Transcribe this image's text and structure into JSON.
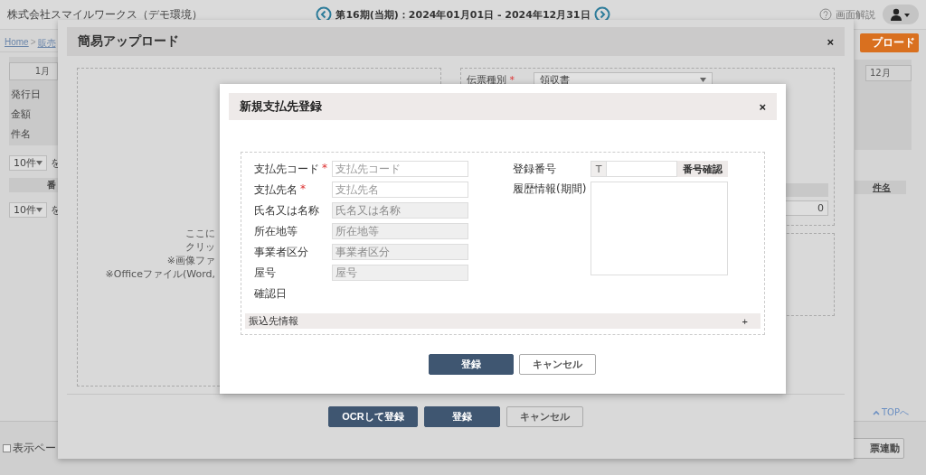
{
  "header": {
    "company": "株式会社スマイルワークス（デモ環境）",
    "period": "第16期(当期)：2024年01月01日 - 2024年12月31日",
    "help": "画面解説"
  },
  "page": {
    "breadcrumb": [
      {
        "label": "Home"
      },
      {
        "label": "販売"
      }
    ],
    "breadcrumb_separator": ">",
    "upload_button": "プロード",
    "months": [
      {
        "label": "1月"
      },
      {
        "label": "12月"
      }
    ],
    "fields": [
      "発行日",
      "金額",
      "件名"
    ],
    "page_size_selects": [
      {
        "value": "10件",
        "suffix": "を"
      },
      {
        "value": "10件",
        "suffix": "を"
      }
    ],
    "table_left_column": "番",
    "table_right_column": "件名",
    "top_link": "TOPへ",
    "footer_checkbox": {
      "label": "表示ペー",
      "checked": false
    },
    "footer_button": "票連動"
  },
  "upload_dialog": {
    "title": "簡易アップロード",
    "close": "×",
    "drop_text": [
      "ここに",
      "クリッ",
      "※画像ファ",
      "※Officeファイル(Word,"
    ],
    "slip_type": {
      "label": "伝票種別",
      "required_mark": "*",
      "value": "領収書"
    },
    "table_cell": "0",
    "buttons": [
      {
        "label": "OCRして登録",
        "kind": "primary"
      },
      {
        "label": "登録",
        "kind": "primary"
      },
      {
        "label": "キャンセル",
        "kind": "secondary"
      }
    ]
  },
  "payee_dialog": {
    "title": "新規支払先登録",
    "close": "×",
    "fields": [
      {
        "label": "支払先コード",
        "required_mark": "*",
        "kind": "input",
        "placeholder": "支払先コード",
        "disabled": false
      },
      {
        "label": "支払先名",
        "required_mark": "*",
        "kind": "input",
        "placeholder": "支払先名",
        "disabled": false
      },
      {
        "label": "氏名又は名称",
        "kind": "input",
        "placeholder": "氏名又は名称",
        "disabled": true
      },
      {
        "label": "所在地等",
        "kind": "input",
        "placeholder": "所在地等",
        "disabled": true
      },
      {
        "label": "事業者区分",
        "kind": "input",
        "placeholder": "事業者区分",
        "disabled": true
      },
      {
        "label": "屋号",
        "kind": "input",
        "placeholder": "屋号",
        "disabled": true
      },
      {
        "label": "確認日",
        "kind": "label"
      }
    ],
    "registration": {
      "label": "登録番号",
      "prefix": "T",
      "button": "番号確認"
    },
    "history": {
      "label": "履歴情報(期間)"
    },
    "bank_section": {
      "label": "振込先情報",
      "toggle": "+"
    },
    "buttons": [
      {
        "label": "登録",
        "kind": "primary"
      },
      {
        "label": "キャンセル",
        "kind": "secondary"
      }
    ]
  }
}
